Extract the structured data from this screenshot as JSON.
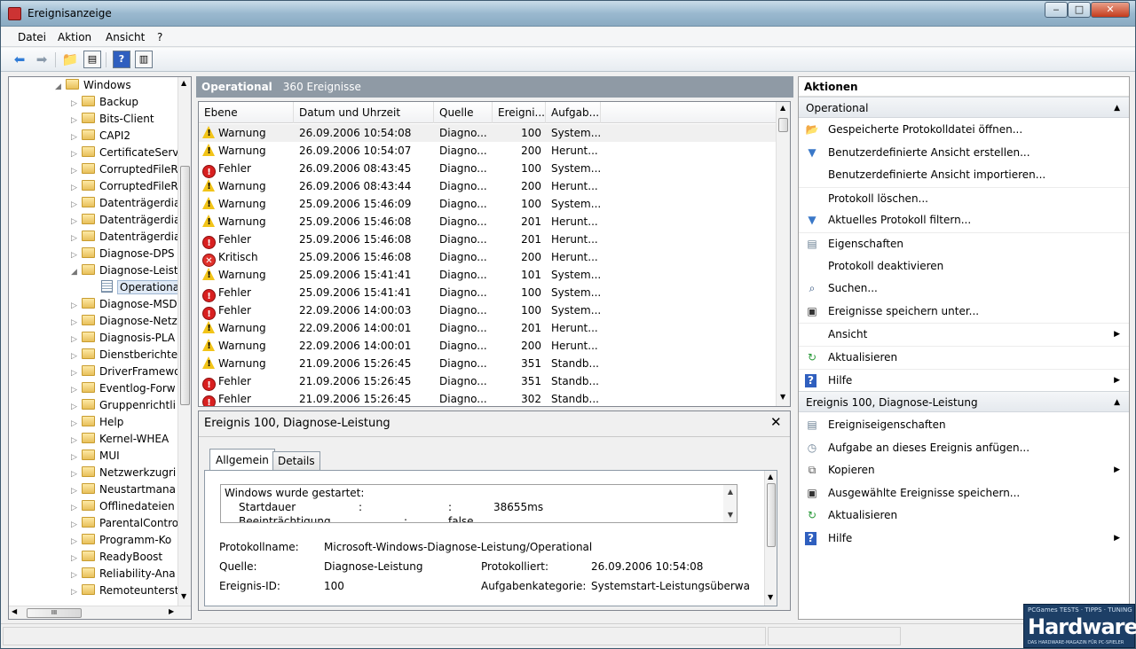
{
  "window": {
    "title": "Ereignisanzeige",
    "btn_min": "‒",
    "btn_max": "□",
    "btn_close": "✕"
  },
  "menu": [
    "Datei",
    "Aktion",
    "Ansicht",
    "?"
  ],
  "tree": {
    "items": [
      {
        "label": "Windows",
        "exp": "◢"
      },
      {
        "label": "Backup",
        "exp": "▷"
      },
      {
        "label": "Bits-Client",
        "exp": "▷"
      },
      {
        "label": "CAPI2",
        "exp": "▷"
      },
      {
        "label": "CertificateServ",
        "exp": "▷"
      },
      {
        "label": "CorruptedFileR",
        "exp": "▷"
      },
      {
        "label": "CorruptedFileR",
        "exp": "▷"
      },
      {
        "label": "Datenträgerdia",
        "exp": "▷"
      },
      {
        "label": "Datenträgerdia",
        "exp": "▷"
      },
      {
        "label": "Datenträgerdia",
        "exp": "▷"
      },
      {
        "label": "Diagnose-DPS",
        "exp": "▷"
      },
      {
        "label": "Diagnose-Leist",
        "exp": "◢"
      },
      {
        "label": "Operational",
        "exp": ""
      },
      {
        "label": "Diagnose-MSD",
        "exp": "▷"
      },
      {
        "label": "Diagnose-Netz",
        "exp": "▷"
      },
      {
        "label": "Diagnosis-PLA",
        "exp": "▷"
      },
      {
        "label": "Dienstberichte",
        "exp": "▷"
      },
      {
        "label": "DriverFramewo",
        "exp": "▷"
      },
      {
        "label": "Eventlog-Forw",
        "exp": "▷"
      },
      {
        "label": "Gruppenrichtli",
        "exp": "▷"
      },
      {
        "label": "Help",
        "exp": "▷"
      },
      {
        "label": "Kernel-WHEA",
        "exp": "▷"
      },
      {
        "label": "MUI",
        "exp": "▷"
      },
      {
        "label": "Netzwerkzugri",
        "exp": "▷"
      },
      {
        "label": "Neustartmana",
        "exp": "▷"
      },
      {
        "label": "Offlinedateien",
        "exp": "▷"
      },
      {
        "label": "ParentalContro",
        "exp": "▷"
      },
      {
        "label": "Programm-Ko",
        "exp": "▷"
      },
      {
        "label": "ReadyBoost",
        "exp": "▷"
      },
      {
        "label": "Reliability-Ana",
        "exp": "▷"
      },
      {
        "label": "Remoteunterst",
        "exp": "▷"
      }
    ],
    "hscroll_thumb_label": "III"
  },
  "log": {
    "name": "Operational",
    "count": "360 Ereignisse"
  },
  "columns": [
    "Ebene",
    "Datum und Uhrzeit",
    "Quelle",
    "Ereigni...",
    "Aufgab..."
  ],
  "events": [
    {
      "level": "Warnung",
      "kind": "warn",
      "date": "26.09.2006 10:54:08",
      "source": "Diagno...",
      "id": "100",
      "task": "System..."
    },
    {
      "level": "Warnung",
      "kind": "warn",
      "date": "26.09.2006 10:54:07",
      "source": "Diagno...",
      "id": "200",
      "task": "Herunt..."
    },
    {
      "level": "Fehler",
      "kind": "err",
      "date": "26.09.2006 08:43:45",
      "source": "Diagno...",
      "id": "100",
      "task": "System..."
    },
    {
      "level": "Warnung",
      "kind": "warn",
      "date": "26.09.2006 08:43:44",
      "source": "Diagno...",
      "id": "200",
      "task": "Herunt..."
    },
    {
      "level": "Warnung",
      "kind": "warn",
      "date": "25.09.2006 15:46:09",
      "source": "Diagno...",
      "id": "100",
      "task": "System..."
    },
    {
      "level": "Warnung",
      "kind": "warn",
      "date": "25.09.2006 15:46:08",
      "source": "Diagno...",
      "id": "201",
      "task": "Herunt..."
    },
    {
      "level": "Fehler",
      "kind": "err",
      "date": "25.09.2006 15:46:08",
      "source": "Diagno...",
      "id": "201",
      "task": "Herunt..."
    },
    {
      "level": "Kritisch",
      "kind": "crit",
      "date": "25.09.2006 15:46:08",
      "source": "Diagno...",
      "id": "200",
      "task": "Herunt..."
    },
    {
      "level": "Warnung",
      "kind": "warn",
      "date": "25.09.2006 15:41:41",
      "source": "Diagno...",
      "id": "101",
      "task": "System..."
    },
    {
      "level": "Fehler",
      "kind": "err",
      "date": "25.09.2006 15:41:41",
      "source": "Diagno...",
      "id": "100",
      "task": "System..."
    },
    {
      "level": "Fehler",
      "kind": "err",
      "date": "22.09.2006 14:00:03",
      "source": "Diagno...",
      "id": "100",
      "task": "System..."
    },
    {
      "level": "Warnung",
      "kind": "warn",
      "date": "22.09.2006 14:00:01",
      "source": "Diagno...",
      "id": "201",
      "task": "Herunt..."
    },
    {
      "level": "Warnung",
      "kind": "warn",
      "date": "22.09.2006 14:00:01",
      "source": "Diagno...",
      "id": "200",
      "task": "Herunt..."
    },
    {
      "level": "Warnung",
      "kind": "warn",
      "date": "21.09.2006 15:26:45",
      "source": "Diagno...",
      "id": "351",
      "task": "Standb..."
    },
    {
      "level": "Fehler",
      "kind": "err",
      "date": "21.09.2006 15:26:45",
      "source": "Diagno...",
      "id": "351",
      "task": "Standb..."
    },
    {
      "level": "Fehler",
      "kind": "err",
      "date": "21.09.2006 15:26:45",
      "source": "Diagno...",
      "id": "302",
      "task": "Standb..."
    }
  ],
  "detail": {
    "title": "Ereignis 100, Diagnose-Leistung",
    "close": "✕",
    "tabs": [
      "Allgemein",
      "Details"
    ],
    "message": {
      "line1": "Windows wurde gestartet:",
      "key1": "Startdauer",
      "sep1": ":",
      "val1": "38655ms",
      "key2": "Beeinträchtigung",
      "sep2": ":",
      "val2": "false"
    },
    "fields": {
      "protokollname_label": "Protokollname:",
      "protokollname": "Microsoft-Windows-Diagnose-Leistung/Operational",
      "quelle_label": "Quelle:",
      "quelle": "Diagnose-Leistung",
      "protokolliert_label": "Protokolliert:",
      "protokolliert": "26.09.2006 10:54:08",
      "ereignisid_label": "Ereignis-ID:",
      "ereignisid": "100",
      "aufgabe_label": "Aufgabenkategorie:",
      "aufgabe": "Systemstart-Leistungsüberwa"
    }
  },
  "actions": {
    "header": "Aktionen",
    "section1": "Operational",
    "items1": [
      {
        "label": "Gespeicherte Protokolldatei öffnen...",
        "icon": "📂"
      },
      {
        "label": "Benutzerdefinierte Ansicht erstellen...",
        "icon": "▼"
      },
      {
        "label": "Benutzerdefinierte Ansicht importieren...",
        "icon": ""
      },
      {
        "label": "Protokoll löschen...",
        "icon": ""
      },
      {
        "label": "Aktuelles Protokoll filtern...",
        "icon": "▼"
      },
      {
        "label": "Eigenschaften",
        "icon": "▤"
      },
      {
        "label": "Protokoll deaktivieren",
        "icon": ""
      },
      {
        "label": "Suchen...",
        "icon": "⌕"
      },
      {
        "label": "Ereignisse speichern unter...",
        "icon": "▣"
      },
      {
        "label": "Ansicht",
        "icon": "",
        "submenu": true
      },
      {
        "label": "Aktualisieren",
        "icon": "↻"
      },
      {
        "label": "Hilfe",
        "icon": "?",
        "submenu": true
      }
    ],
    "section2": "Ereignis 100, Diagnose-Leistung",
    "items2": [
      {
        "label": "Ereigniseigenschaften",
        "icon": "▤"
      },
      {
        "label": "Aufgabe an dieses Ereignis anfügen...",
        "icon": "◷"
      },
      {
        "label": "Kopieren",
        "icon": "⧉",
        "submenu": true
      },
      {
        "label": "Ausgewählte Ereignisse speichern...",
        "icon": "▣"
      },
      {
        "label": "Aktualisieren",
        "icon": "↻"
      },
      {
        "label": "Hilfe",
        "icon": "?",
        "submenu": true
      }
    ]
  },
  "logo": {
    "small": "PCGames TESTS · TIPPS · TUNING",
    "big": "Hardware",
    "tag": "DAS HARDWARE-MAGAZIN FÜR PC-SPIELER"
  },
  "colors": {
    "warning": "#f2c418",
    "error": "#d82020",
    "accent": "#8f9aa5"
  }
}
